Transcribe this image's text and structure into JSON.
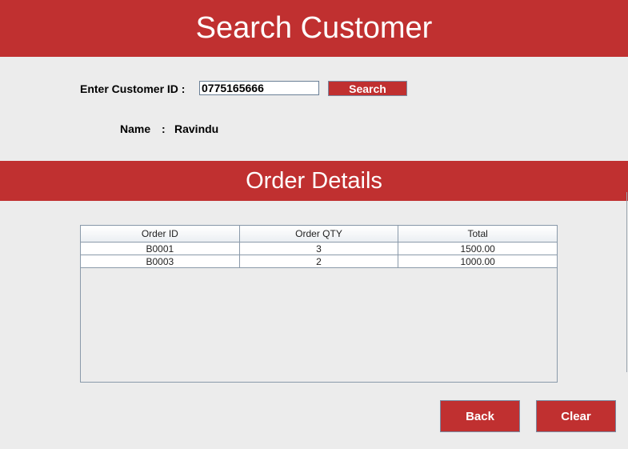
{
  "header": {
    "title": "Search Customer"
  },
  "search": {
    "label": "Enter Customer ID :",
    "value": "0775165666",
    "button_label": "Search"
  },
  "customer": {
    "name_label": "Name",
    "separator": ":",
    "name_value": "Ravindu"
  },
  "orders": {
    "title": "Order Details",
    "columns": [
      "Order ID",
      "Order QTY",
      "Total"
    ],
    "rows": [
      [
        "B0001",
        "3",
        "1500.00"
      ],
      [
        "B0003",
        "2",
        "1000.00"
      ]
    ]
  },
  "actions": {
    "back_label": "Back",
    "clear_label": "Clear"
  },
  "colors": {
    "accent": "#c03030",
    "background": "#ececec"
  }
}
